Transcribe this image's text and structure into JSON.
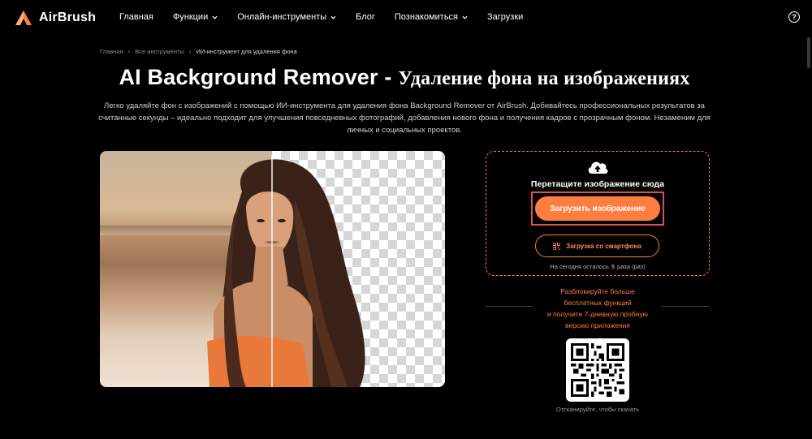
{
  "brand": {
    "name": "AirBrush",
    "accent": "#ff7e3f"
  },
  "nav": {
    "items": [
      {
        "label": "Главная",
        "dropdown": false
      },
      {
        "label": "Функции",
        "dropdown": true
      },
      {
        "label": "Онлайн-инструменты",
        "dropdown": true
      },
      {
        "label": "Блог",
        "dropdown": false
      },
      {
        "label": "Познакомиться",
        "dropdown": true
      },
      {
        "label": "Загрузки",
        "dropdown": false
      }
    ],
    "help_icon": "question-circle-icon"
  },
  "breadcrumb": [
    "Главная",
    "Все инструменты",
    "ИИ-инструмент для удаления фона"
  ],
  "page": {
    "title_en": "AI Background Remover - ",
    "title_ru": "Удаление фона на изображениях",
    "description": "Легко удаляйте фон с изображений с помощью ИИ-инструмента для удаления фона Background Remover от AirBrush. Добивайтесь профессиональных результатов за считанные секунды – идеально подходит для улучшения повседневных фотографий, добавления нового фона и получения кадров с прозрачным фоном. Незаменим для личных и социальных проектов."
  },
  "upload": {
    "drop_text": "Перетащите изображение сюда",
    "upload_button": "Загрузить изображение",
    "phone_button": "Загрузка со смартфона",
    "remain_prefix": "На сегодня осталось",
    "remain_count": "5",
    "remain_suffix": "раза (раз)"
  },
  "promo": {
    "line1": "Разблокируйте больше",
    "line2": "бесплатных функций",
    "line3": "и получите 7-дневную пробную",
    "line4": "версию приложения",
    "qr_caption": "Отсканируйте, чтобы скачать"
  }
}
